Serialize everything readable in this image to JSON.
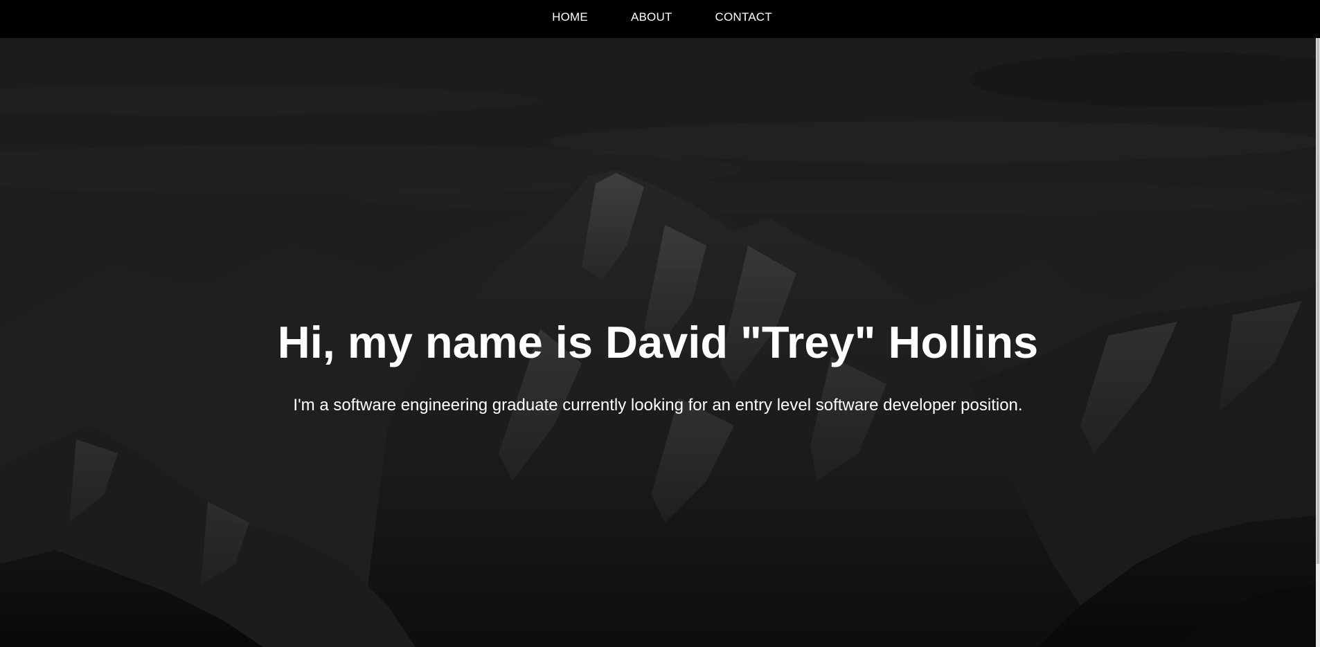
{
  "nav": {
    "items": [
      {
        "label": "HOME"
      },
      {
        "label": "ABOUT"
      },
      {
        "label": "CONTACT"
      }
    ]
  },
  "hero": {
    "title": "Hi, my name is David \"Trey\" Hollins",
    "subtitle": "I'm a software engineering graduate currently looking for an entry level software developer position.",
    "background_icon": "mountain-landscape-image"
  },
  "colors": {
    "nav_background": "#000000",
    "text": "#ffffff",
    "overlay": "#1c1c1c"
  }
}
